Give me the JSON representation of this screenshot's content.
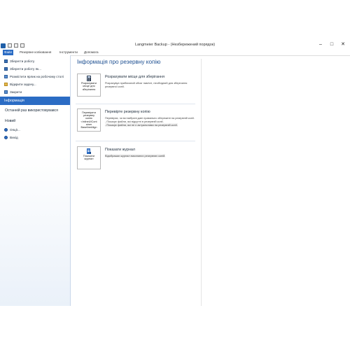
{
  "window": {
    "title": "Langmeier Backup - (Незбережений порядок)",
    "minimize": "–",
    "maximize": "□",
    "close": "✕"
  },
  "menu": {
    "tabs": [
      "Файл",
      "Резервне копіювання",
      "Інструменти",
      "Допомога"
    ]
  },
  "sidebar": {
    "items": [
      {
        "label": "Зберегти роботу",
        "icon": "save-icon"
      },
      {
        "label": "Зберегти роботу як...",
        "icon": "save-as-icon"
      },
      {
        "label": "Розмістити ярлик на робочому столі",
        "icon": "shortcut-icon"
      },
      {
        "label": "Відкрити задачу...",
        "icon": "open-task-icon"
      },
      {
        "label": "Закрити",
        "icon": "close-folder-icon"
      }
    ],
    "active": "Інформація",
    "recent": "Останній раз використовувався",
    "new": "Новий",
    "options": "Опції...",
    "exit": "Вихід"
  },
  "main": {
    "title": "Інформація про резервну копію",
    "sections": [
      {
        "button": "Розрахувати місце для зберігання",
        "title": "Розрахувати місце для зберігання",
        "desc": "Розрахувує приблизний обсяг пам'яті, необхідний для зберігання резервної копії."
      },
      {
        "button": "Пере&#x0301;вірити резервну копію <InlineUICont ainer BaselineAlign",
        "button_lines": [
          "Перевірити резервну",
          "копію",
          "<InlineUICont",
          "ainer",
          "BaselineAlign"
        ],
        "title": "Перевірте резервну копію",
        "desc_lines": [
          "Перевіряє, чи всі вибрані дані правильно збережені на резервній копії.",
          "- Показує файли, які відсутні в резервній копії.",
          "- Показує файли, які не є актуальними на резервній копії."
        ]
      },
      {
        "button": "Показати журнал",
        "title": "Показати журнал",
        "desc": "Відображає журнал виконаних резервних копій."
      }
    ]
  }
}
